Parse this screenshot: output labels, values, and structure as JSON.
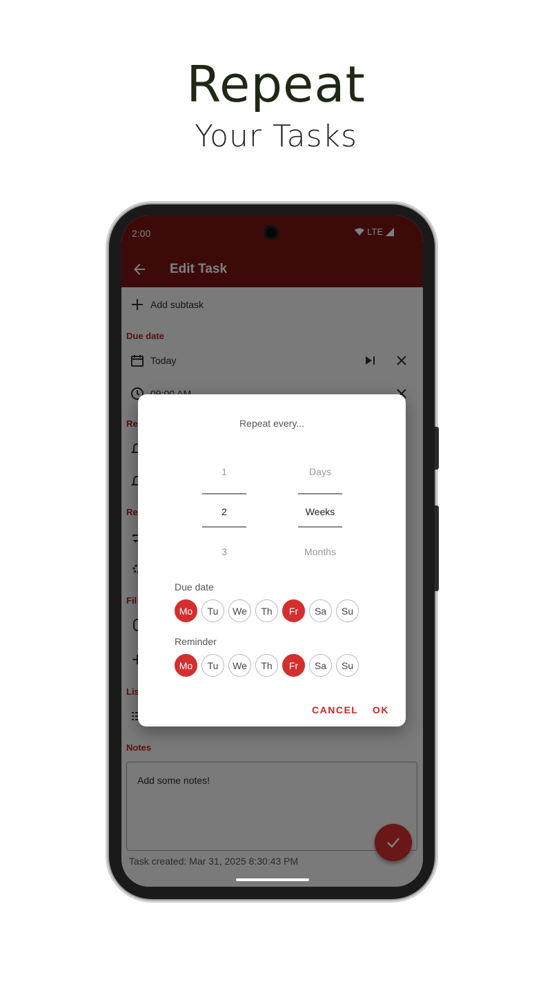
{
  "headline": {
    "title": "Repeat",
    "subtitle": "Your Tasks"
  },
  "status_bar": {
    "time": "2:00",
    "network": "LTE"
  },
  "app_bar": {
    "title": "Edit Task"
  },
  "task": {
    "add_subtask": "Add subtask",
    "due_date_section": "Due date",
    "due_date_value": "Today",
    "due_time_value": "09:00 AM",
    "section_re1": "Re",
    "section_re2": "Re",
    "section_fil": "Fil",
    "section_lis": "Lis",
    "notes_section": "Notes",
    "notes_placeholder": "Add some notes!",
    "created": "Task created: Mar 31, 2025 8:30:43 PM"
  },
  "dialog": {
    "title": "Repeat every...",
    "number_picker": {
      "above": "1",
      "selected": "2",
      "below": "3"
    },
    "unit_picker": {
      "above": "Days",
      "selected": "Weeks",
      "below": "Months"
    },
    "due_date_label": "Due date",
    "reminder_label": "Reminder",
    "due_days": [
      {
        "label": "Mo",
        "selected": true
      },
      {
        "label": "Tu",
        "selected": false
      },
      {
        "label": "We",
        "selected": false
      },
      {
        "label": "Th",
        "selected": false
      },
      {
        "label": "Fr",
        "selected": true
      },
      {
        "label": "Sa",
        "selected": false
      },
      {
        "label": "Su",
        "selected": false
      }
    ],
    "reminder_days": [
      {
        "label": "Mo",
        "selected": true
      },
      {
        "label": "Tu",
        "selected": false
      },
      {
        "label": "We",
        "selected": false
      },
      {
        "label": "Th",
        "selected": false
      },
      {
        "label": "Fr",
        "selected": true
      },
      {
        "label": "Sa",
        "selected": false
      },
      {
        "label": "Su",
        "selected": false
      }
    ],
    "cancel": "CANCEL",
    "ok": "OK"
  },
  "colors": {
    "primary": "#7a1515",
    "accent": "#d32f2f",
    "headline": "#1e2814"
  }
}
